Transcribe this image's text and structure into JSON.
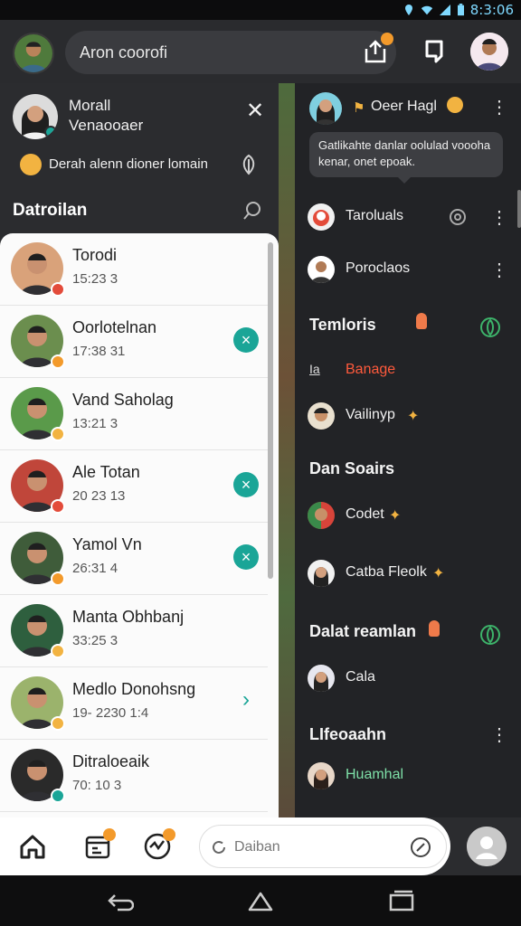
{
  "status_bar": {
    "time": "8:3:06"
  },
  "top_bar": {
    "search_text": "Aron coorofi"
  },
  "left_drawer": {
    "profile_name_line1": "Morall",
    "profile_name_line2": "Venaooaer",
    "status_text": "Derah alenn dioner lomain",
    "section_title": "Datroilan",
    "contacts": [
      {
        "name": "Torodi",
        "time": "15:23 3",
        "color": "#d9a27a",
        "badge": "#e34b3a"
      },
      {
        "name": "Oorlotelnan",
        "time": "17:38 31",
        "color": "#6b8e4e",
        "badge": "#f39a2b",
        "action": "×"
      },
      {
        "name": "Vand Saholag",
        "time": "13:21 3",
        "color": "#5a9a4a",
        "badge": "#f2b341"
      },
      {
        "name": "Ale Totan",
        "time": "20 23 13",
        "color": "#c0463a",
        "badge": "#e34b3a",
        "action": "×"
      },
      {
        "name": "Yamol Vn",
        "time": "26:31 4",
        "color": "#3f5c3a",
        "badge": "#f39a2b",
        "action": "×"
      },
      {
        "name": "Manta Obhbanj",
        "time": "33:25 3",
        "color": "#2e5f3e",
        "badge": "#f2b341"
      },
      {
        "name": "Medlo Donohsng",
        "time": "19- 2230 1:4",
        "color": "#9bb36c",
        "badge": "#f2b341",
        "chevron": "›"
      },
      {
        "name": "Ditraloeaik",
        "time": "70: 10 3",
        "color": "#2a2a2a",
        "badge": "#1aa597"
      }
    ]
  },
  "right_panel": {
    "header_name": "Oeer Hagl",
    "tooltip": "Gatlikahte danlar oolulad voooha kenar, onet epoak.",
    "rows": [
      {
        "label": "Taroluals"
      },
      {
        "label": "Poroclaos"
      }
    ],
    "section1": "Temloris",
    "banage_prefix": "Ia",
    "banage": "Banage",
    "vailinyp": "Vailinyp",
    "section2": "Dan Soairs",
    "codet": "Codet",
    "catba": "Catba Fleolk",
    "section3": "Dalat reamlan",
    "cala": "Cala",
    "section4": "LIfeoaahn",
    "huamhal": "Huamhal",
    "colors": {
      "banage": "#ff5a3c",
      "huamhal": "#7ee0a8",
      "accent": "#1aa597"
    }
  },
  "bottom_bar": {
    "search_placeholder": "Daiban"
  }
}
